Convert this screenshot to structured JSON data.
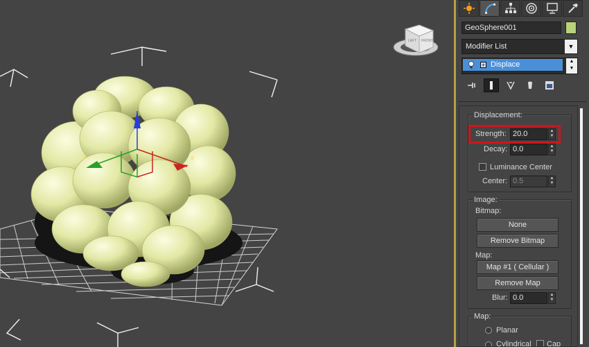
{
  "object": {
    "name": "GeoSphere001",
    "color": "#b8d27a"
  },
  "modifier_list": {
    "label": "Modifier List"
  },
  "stack": {
    "items": [
      {
        "label": "Displace"
      }
    ]
  },
  "command_tabs": [
    "create",
    "modify",
    "hierarchy",
    "motion",
    "display",
    "utilities"
  ],
  "viewcube": {
    "left": "LEFT",
    "front": "FRONT"
  },
  "axes": {
    "x": "x",
    "y": "y",
    "z": "z"
  },
  "displacement": {
    "title": "Displacement:",
    "strength_label": "Strength:",
    "strength_value": "20.0",
    "decay_label": "Decay:",
    "decay_value": "0.0",
    "luminance_label": "Luminance Center",
    "center_label": "Center:",
    "center_value": "0.5"
  },
  "image": {
    "title": "Image:",
    "bitmap_label": "Bitmap:",
    "bitmap_button": "None",
    "remove_bitmap": "Remove Bitmap",
    "map_label": "Map:",
    "map_button": "Map #1  ( Cellular )",
    "remove_map": "Remove Map",
    "blur_label": "Blur:",
    "blur_value": "0.0"
  },
  "mapping": {
    "title": "Map:",
    "planar": "Planar",
    "cylindrical": "Cylindrical",
    "cap": "Cap"
  },
  "colors": {
    "selection_blue": "#4a90d9",
    "highlight_red": "#d0141c",
    "object_yellow": "#e3e9a5",
    "border_gold": "#b6a046"
  }
}
